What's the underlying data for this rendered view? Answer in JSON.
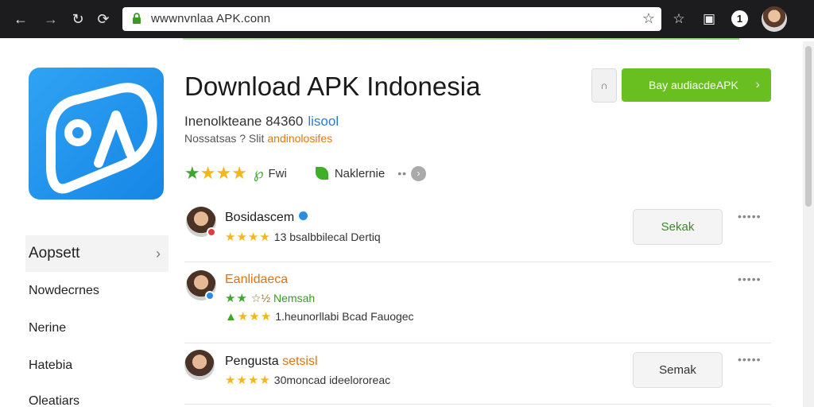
{
  "browser": {
    "url": "wwwnvnlaa APK.conn",
    "notification_count": "1"
  },
  "app": {
    "title": "Download APK Indonesia",
    "subtitle": "Inenolkteane 84360",
    "subtitle_link": "lisool",
    "detail": "Nossatsas ? Slit",
    "detail_link": "andinolosifes",
    "rating_label": "Fwi",
    "developer": "Naklernie",
    "download_label": "Bay audiacdeAPK",
    "colors": {
      "brand": "#1686e6",
      "accent": "#69bf1f"
    }
  },
  "sidebar": {
    "items": [
      {
        "label": "Aopsett",
        "active": true
      },
      {
        "label": "Nowdecrnes"
      },
      {
        "label": "Nerine"
      },
      {
        "label": "Hatebia"
      },
      {
        "label": "Oleatiars"
      }
    ]
  },
  "reviews": [
    {
      "name": "Bosidascem",
      "lines": [
        "13 bsalbbilecal Dertiq"
      ],
      "action_label": "Sekak"
    },
    {
      "name": "Eanlidaeca",
      "lines": [
        "Nemsah",
        "1.heunorllabi Bcad Fauogec"
      ]
    },
    {
      "name": "Pengusta",
      "name_tag": "setsisl",
      "lines": [
        "30moncad ideelororeac"
      ],
      "action_label": "Semak"
    }
  ]
}
